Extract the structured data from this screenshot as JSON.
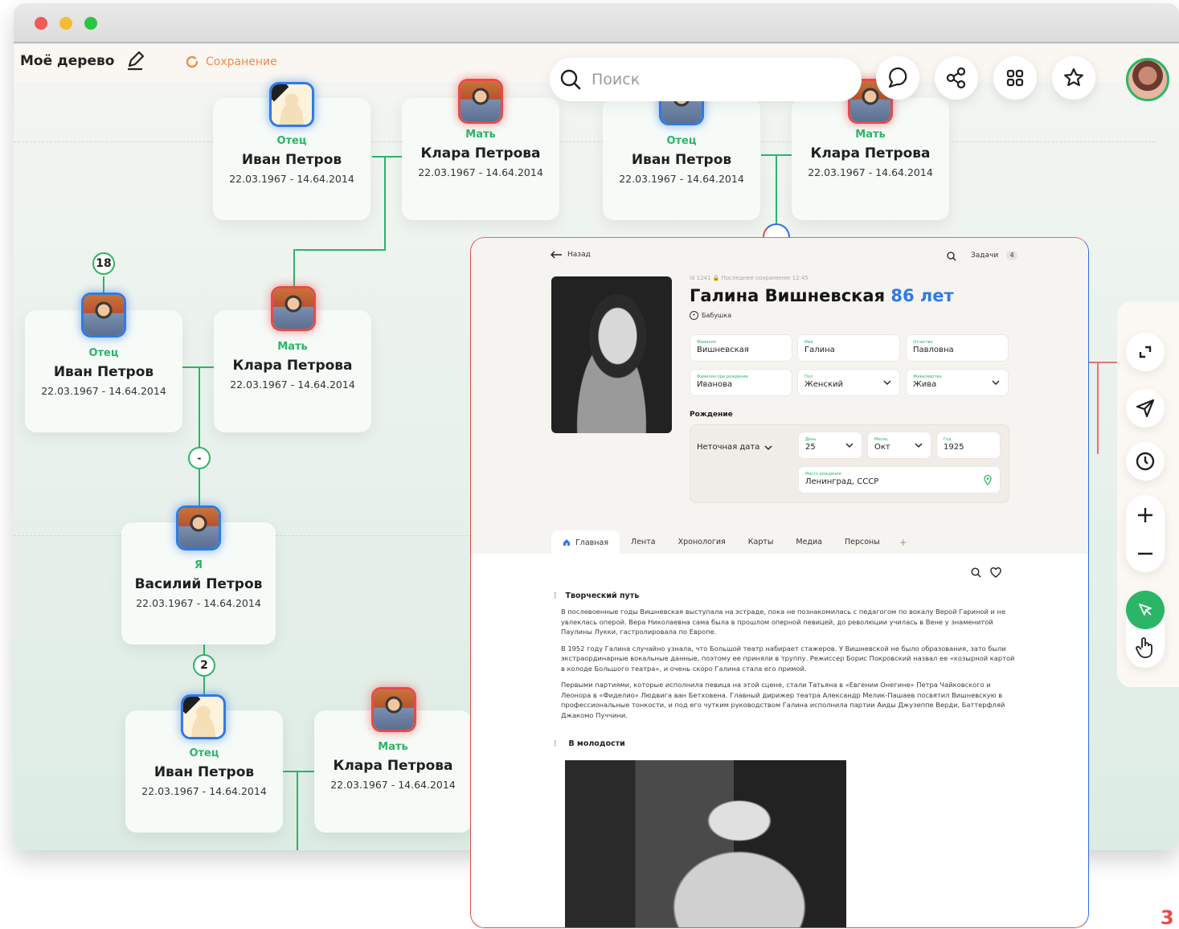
{
  "toolbar": {
    "tree_name": "Моё дерево",
    "saving": "Сохранение",
    "search_placeholder": "Поиск"
  },
  "tree": {
    "cards": [
      {
        "role": "Отец",
        "name": "Иван Петров",
        "dates": "22.03.1967 - 14.64.2014"
      },
      {
        "role": "Мать",
        "name": "Клара Петрова",
        "dates": "22.03.1967 - 14.64.2014"
      },
      {
        "role": "Отец",
        "name": "Иван Петров",
        "dates": "22.03.1967 - 14.64.2014"
      },
      {
        "role": "Мать",
        "name": "Клара Петрова",
        "dates": "22.03.1967 - 14.64.2014"
      },
      {
        "role": "Отец",
        "name": "Иван Петров",
        "dates": "22.03.1967 - 14.64.2014"
      },
      {
        "role": "Мать",
        "name": "Клара Петрова",
        "dates": "22.03.1967 - 14.64.2014"
      },
      {
        "role": "Я",
        "name": "Василий Петров",
        "dates": "22.03.1967 - 14.64.2014"
      },
      {
        "role": "Отец",
        "name": "Иван Петров",
        "dates": "22.03.1967 - 14.64.2014"
      },
      {
        "role": "Мать",
        "name": "Клара Петрова",
        "dates": "22.03.1967 - 14.64.2014"
      }
    ],
    "badges": {
      "b1": "18",
      "b2": "2",
      "collapse": "-"
    }
  },
  "panel": {
    "back": "Назад",
    "tasks": "Задачи",
    "tasks_count": "4",
    "meta": "id 1241  🔒 Последнее сохранение 12:45",
    "name": "Галина Вишневская",
    "age": "86 лет",
    "relation": "Бабушка",
    "fields": {
      "surname": {
        "label": "Фамилия",
        "value": "Вишневская"
      },
      "first": {
        "label": "Имя",
        "value": "Галина"
      },
      "patronymic": {
        "label": "Отчество",
        "value": "Павловна"
      },
      "maiden": {
        "label": "Фамилия при рождении",
        "value": "Иванова"
      },
      "sex": {
        "label": "Пол",
        "value": "Женский"
      },
      "alive": {
        "label": "Жива/мертва",
        "value": "Жива"
      }
    },
    "birth": {
      "section": "Рождение",
      "inexact": "Неточная дата",
      "day": {
        "label": "День",
        "value": "25"
      },
      "month": {
        "label": "Месяц",
        "value": "Окт"
      },
      "year": {
        "label": "Год",
        "value": "1925"
      },
      "place": {
        "label": "Место рождения",
        "value": "Ленинград, СССР"
      }
    },
    "tabs": [
      "Главная",
      "Лента",
      "Хронология",
      "Карты",
      "Медиа",
      "Персоны"
    ],
    "section1": {
      "title": "Творческий путь",
      "p1": "В послевоенные годы Вишневская выступала на эстраде, пока не познакомилась с педагогом по вокалу Верой Гариной и не увлеклась оперой. Вера Николаевна сама была в прошлом оперной певицей, до революции училась в Вене у знаменитой Паулины Лукки, гастролировала по Европе.",
      "p2": "В 1952 году Галина случайно узнала, что Большой театр набирает стажеров. У Вишневской не было образования, зато были экстраординарные вокальные данные, поэтому ее приняли в труппу. Режиссер Борис Покровский назвал ее «козырной картой в колоде Большого театра», и очень скоро Галина стала его примой.",
      "p3": "Первыми партиями, которые исполнила певица на этой сцене, стали Татьяна в «Евгении Онегине» Петра Чайковского и Леонора в «Фиделио» Людвига ван Бетховена. Главный дирижер театра Александр Мелик-Пашаев посвятил Вишневскую в профессиональные тонкости, и под его чутким руководством Галина исполнила партии Аиды Джузеппе Верди, Баттерфляй Джакомо Пуччини."
    },
    "section2": {
      "title": "В молодости"
    }
  },
  "brand": "3",
  "colors": {
    "green": "#2bb566",
    "blue": "#2f7ae5",
    "red": "#e84a4a",
    "orange": "#f08a4b"
  }
}
